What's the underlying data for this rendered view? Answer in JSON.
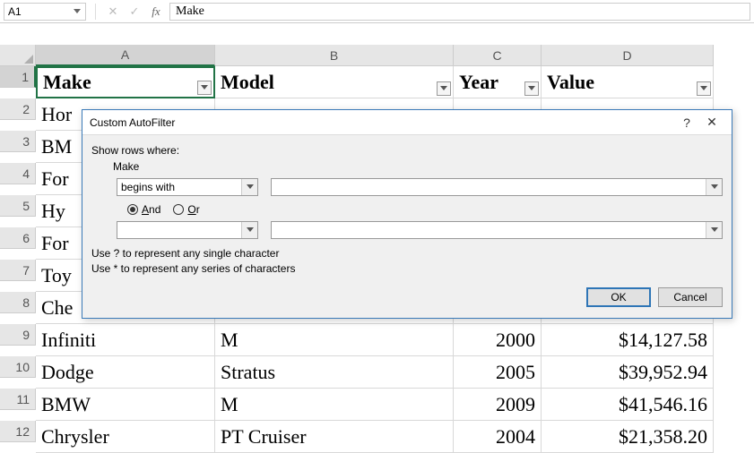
{
  "formula_bar": {
    "name_box": "A1",
    "formula_value": "Make"
  },
  "columns": [
    "A",
    "B",
    "C",
    "D"
  ],
  "headers": {
    "make": "Make",
    "model": "Model",
    "year": "Year",
    "value": "Value"
  },
  "rows": [
    {
      "n": "2",
      "make": "Hor"
    },
    {
      "n": "3",
      "make": "BM"
    },
    {
      "n": "4",
      "make": "For"
    },
    {
      "n": "5",
      "make": "Hy"
    },
    {
      "n": "6",
      "make": "For"
    },
    {
      "n": "7",
      "make": "Toy"
    },
    {
      "n": "8",
      "make": "Che"
    },
    {
      "n": "9",
      "make": "Infiniti",
      "model": "M",
      "year": "2000",
      "value": "$14,127.58"
    },
    {
      "n": "10",
      "make": "Dodge",
      "model": "Stratus",
      "year": "2005",
      "value": "$39,952.94"
    },
    {
      "n": "11",
      "make": "BMW",
      "model": "M",
      "year": "2009",
      "value": "$41,546.16"
    },
    {
      "n": "12",
      "make": "Chrysler",
      "model": "PT Cruiser",
      "year": "2004",
      "value": "$21,358.20"
    }
  ],
  "dialog": {
    "title": "Custom AutoFilter",
    "show_rows_where": "Show rows where:",
    "field_name": "Make",
    "condition1": "begins with",
    "value1": "",
    "and_label": "And",
    "or_label": "Or",
    "and_selected": true,
    "condition2": "",
    "value2": "",
    "hint1": "Use ? to represent any single character",
    "hint2": "Use * to represent any series of characters",
    "ok": "OK",
    "cancel": "Cancel",
    "help_symbol": "?",
    "close_symbol": "✕"
  },
  "chart_data": {
    "type": "table",
    "columns": [
      "Make",
      "Model",
      "Year",
      "Value"
    ],
    "rows_visible": [
      {
        "Make": "Infiniti",
        "Model": "M",
        "Year": 2000,
        "Value": 14127.58
      },
      {
        "Make": "Dodge",
        "Model": "Stratus",
        "Year": 2005,
        "Value": 39952.94
      },
      {
        "Make": "BMW",
        "Model": "M",
        "Year": 2009,
        "Value": 41546.16
      },
      {
        "Make": "Chrysler",
        "Model": "PT Cruiser",
        "Year": 2004,
        "Value": 21358.2
      }
    ]
  }
}
